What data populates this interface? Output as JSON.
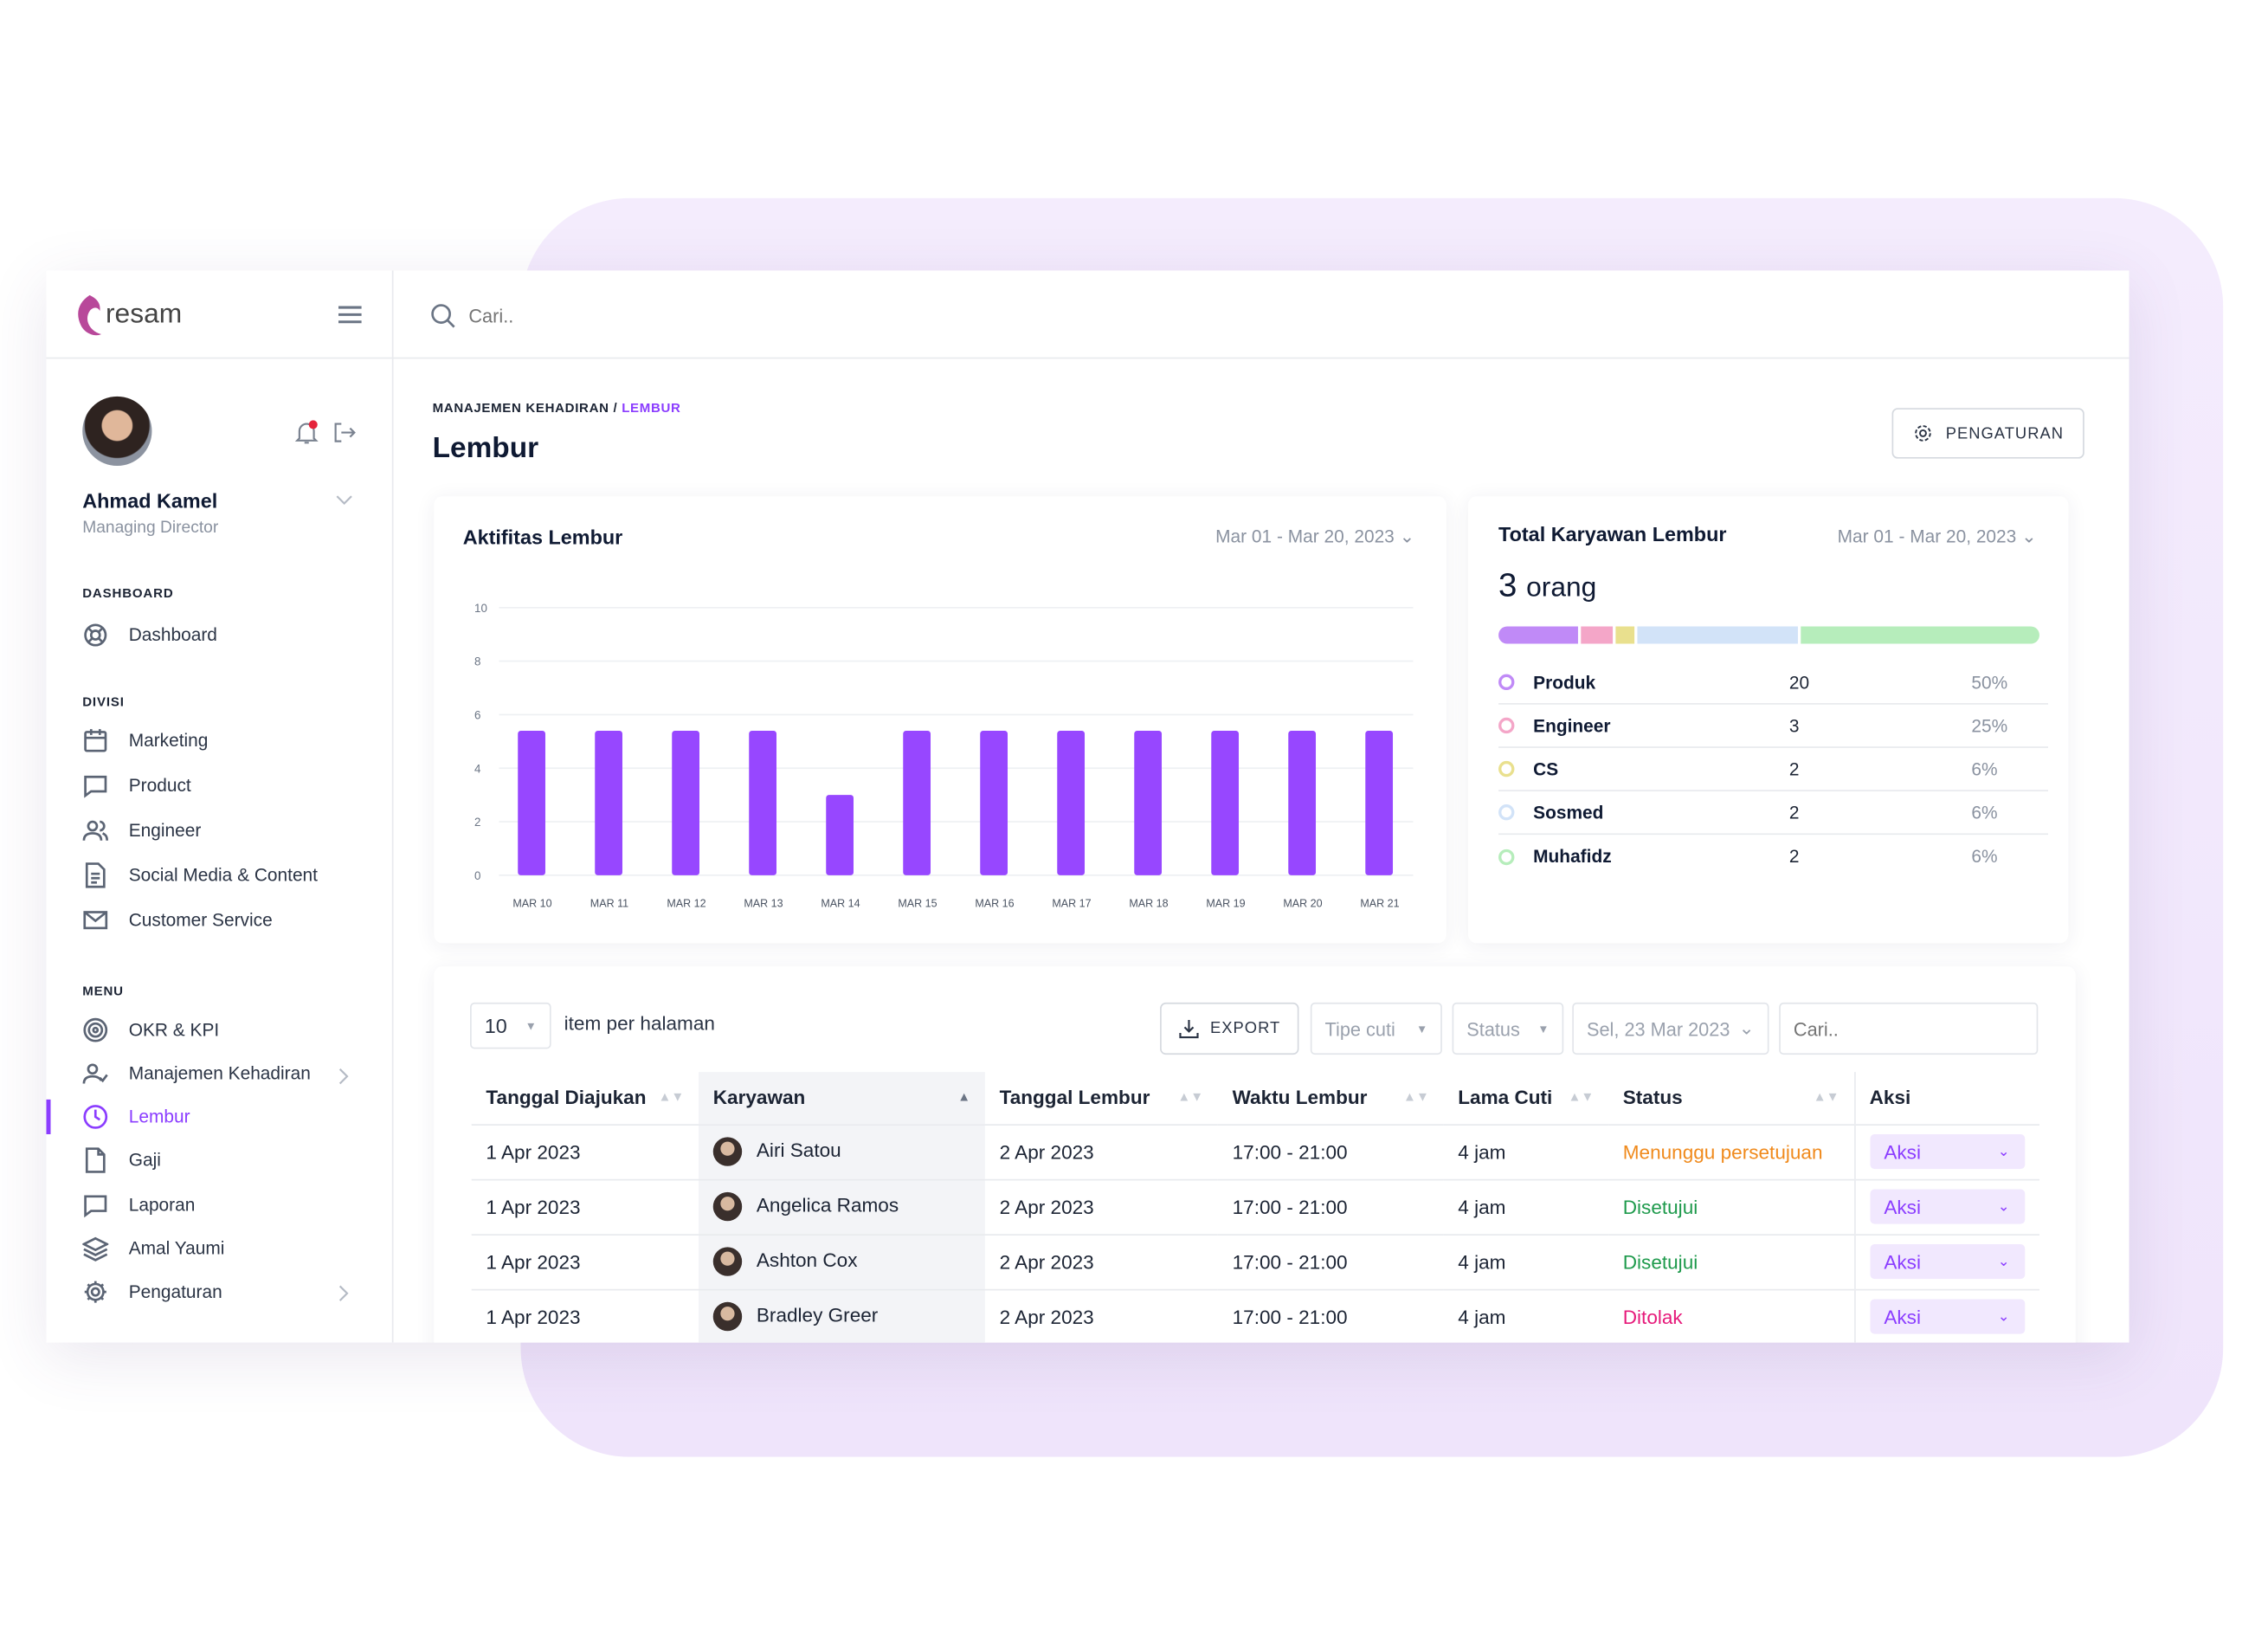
{
  "app": {
    "brand": "resam"
  },
  "search": {
    "placeholder": "Cari.."
  },
  "user": {
    "name": "Ahmad Kamel",
    "role": "Managing Director"
  },
  "sidebar": {
    "dashboard_title": "DASHBOARD",
    "dashboard_items": [
      {
        "label": "Dashboard",
        "icon": "lifebuoy-icon"
      }
    ],
    "divisi_title": "DIVISI",
    "divisi_items": [
      {
        "label": "Marketing",
        "icon": "calendar-icon"
      },
      {
        "label": "Product",
        "icon": "chat-icon"
      },
      {
        "label": "Engineer",
        "icon": "users-icon"
      },
      {
        "label": "Social Media & Content",
        "icon": "document-icon"
      },
      {
        "label": "Customer Service",
        "icon": "mail-icon"
      }
    ],
    "menu_title": "MENU",
    "menu_items": [
      {
        "label": "OKR & KPI",
        "icon": "target-icon"
      },
      {
        "label": "Manajemen Kehadiran",
        "icon": "user-check-icon"
      },
      {
        "label": "Lembur",
        "icon": "clock-icon",
        "active": true
      },
      {
        "label": "Gaji",
        "icon": "file-icon"
      },
      {
        "label": "Laporan",
        "icon": "chat-icon"
      },
      {
        "label": "Amal Yaumi",
        "icon": "layers-icon"
      },
      {
        "label": "Pengaturan",
        "icon": "gear-icon"
      }
    ]
  },
  "header": {
    "breadcrumb_parent": "MANAJEMEN KEHADIRAN",
    "breadcrumb_sep": "/",
    "breadcrumb_current": "LEMBUR",
    "title": "Lembur",
    "settings_label": "PENGATURAN"
  },
  "activity": {
    "title": "Aktifitas Lembur",
    "range": "Mar 01 - Mar 20, 2023"
  },
  "chart_data": {
    "type": "bar",
    "title": "Aktifitas Lembur",
    "categories": [
      "MAR 10",
      "MAR 11",
      "MAR 12",
      "MAR 13",
      "MAR 14",
      "MAR 15",
      "MAR 16",
      "MAR 17",
      "MAR 18",
      "MAR 19",
      "MAR 20",
      "MAR 21"
    ],
    "values": [
      5.4,
      5.4,
      5.4,
      5.4,
      3.0,
      5.4,
      5.4,
      5.4,
      5.4,
      5.4,
      5.4,
      5.4
    ],
    "ylim": [
      0,
      10
    ],
    "yticks": [
      "0",
      "2",
      "4",
      "6",
      "8",
      "10"
    ],
    "grid": true,
    "color": "#9747ff"
  },
  "total": {
    "title": "Total Karyawan Lembur",
    "range": "Mar 01 - Mar 20, 2023",
    "count": "3",
    "unit": "orang",
    "items": [
      {
        "label": "Produk",
        "value": "20",
        "pct": "50%",
        "color": "#c08af7",
        "share": 15
      },
      {
        "label": "Engineer",
        "value": "3",
        "pct": "25%",
        "color": "#f4a6c8",
        "share": 6
      },
      {
        "label": "CS",
        "value": "2",
        "pct": "6%",
        "color": "#e9e08e",
        "share": 3.5
      },
      {
        "label": "Sosmed",
        "value": "2",
        "pct": "6%",
        "color": "#d2e3f8",
        "share": 30.5
      },
      {
        "label": "Muhafidz",
        "value": "2",
        "pct": "6%",
        "color": "#b6edbb",
        "share": 45
      }
    ]
  },
  "table": {
    "page_size": "10",
    "page_size_label": "item per halaman",
    "export_label": "EXPORT",
    "type_filter": "Tipe cuti",
    "status_filter": "Status",
    "date_filter": "Sel, 23 Mar 2023",
    "search_placeholder": "Cari..",
    "columns": [
      "Tanggal Diajukan",
      "Karyawan",
      "Tanggal Lembur",
      "Waktu Lembur",
      "Lama Cuti",
      "Status",
      "Aksi"
    ],
    "rows": [
      {
        "submitted": "1 Apr 2023",
        "employee": "Airi Satou",
        "date": "2 Apr 2023",
        "time": "17:00 - 21:00",
        "duration": "4 jam",
        "status": "Menunggu persetujuan",
        "status_color": "#f08a1c",
        "action": "Aksi"
      },
      {
        "submitted": "1 Apr 2023",
        "employee": "Angelica Ramos",
        "date": "2 Apr 2023",
        "time": "17:00 - 21:00",
        "duration": "4 jam",
        "status": "Disetujui",
        "status_color": "#1e9a4c",
        "action": "Aksi"
      },
      {
        "submitted": "1 Apr 2023",
        "employee": "Ashton Cox",
        "date": "2 Apr 2023",
        "time": "17:00 - 21:00",
        "duration": "4 jam",
        "status": "Disetujui",
        "status_color": "#1e9a4c",
        "action": "Aksi"
      },
      {
        "submitted": "1 Apr 2023",
        "employee": "Bradley Greer",
        "date": "2 Apr 2023",
        "time": "17:00 - 21:00",
        "duration": "4 jam",
        "status": "Ditolak",
        "status_color": "#e6197a",
        "action": "Aksi"
      }
    ]
  }
}
